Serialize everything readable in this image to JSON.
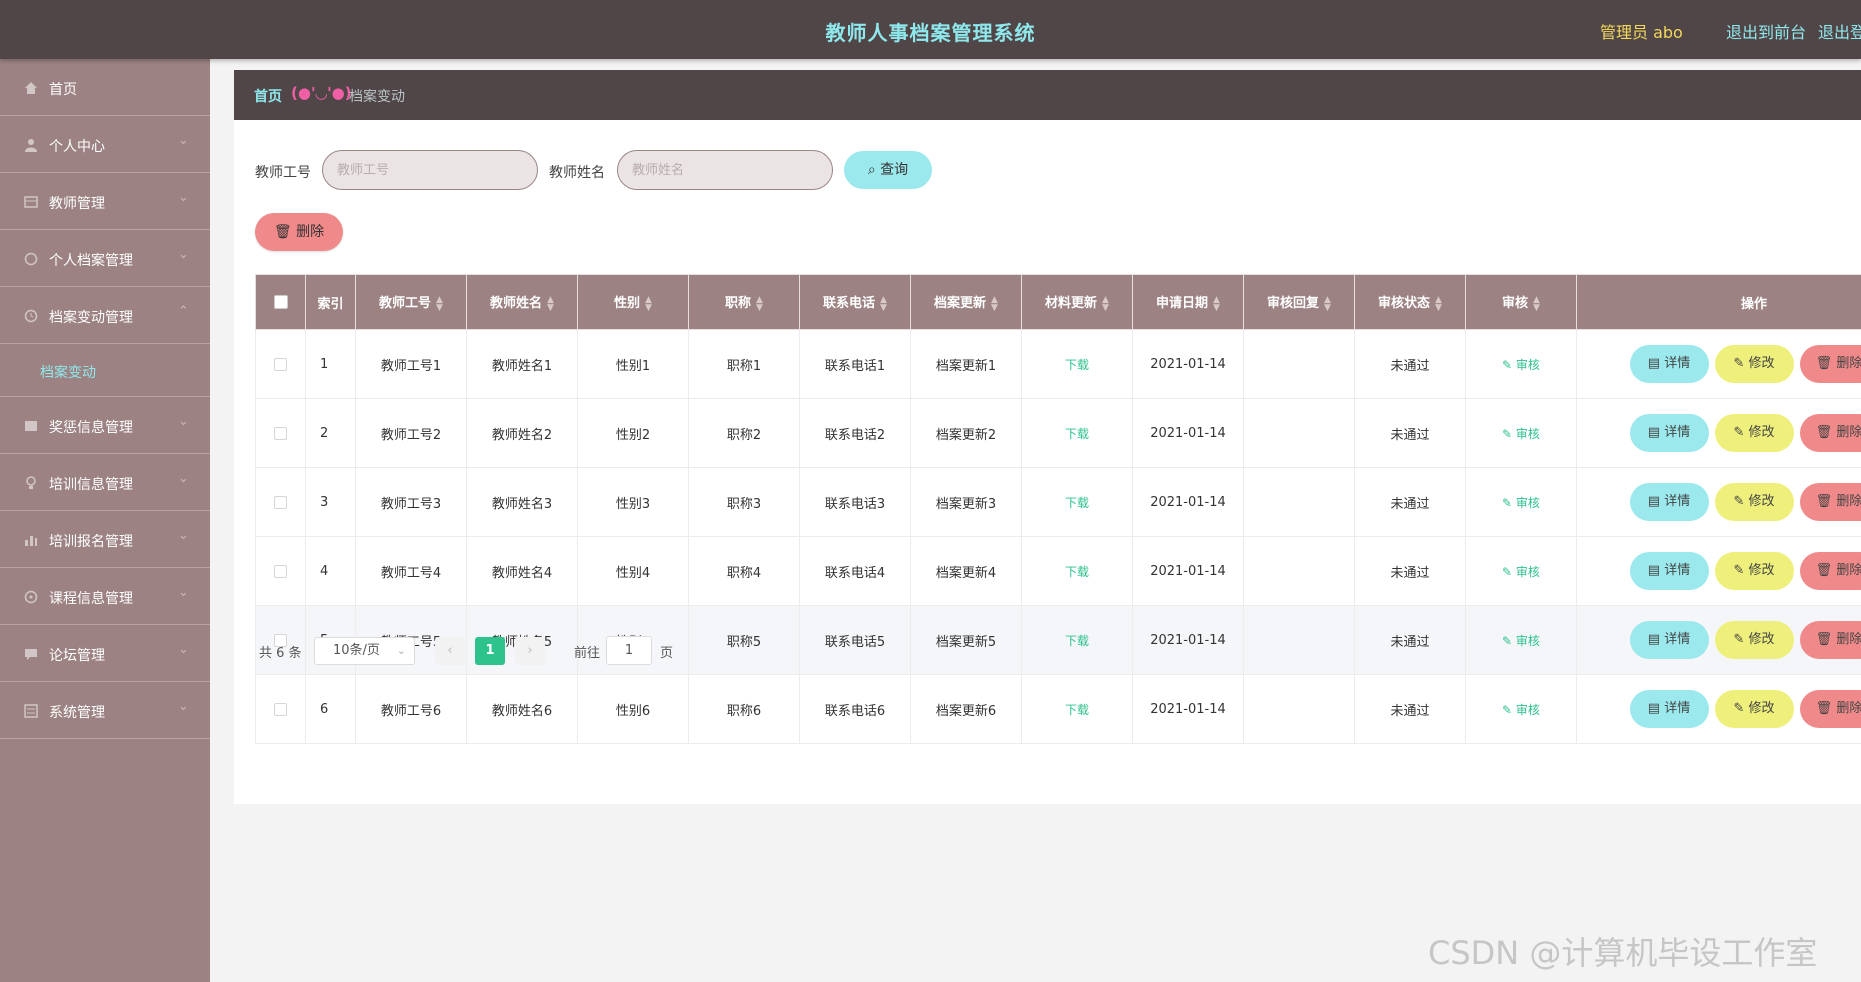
{
  "header": {
    "title": "教师人事档案管理系统",
    "admin": "管理员 abo",
    "to_front": "退出到前台",
    "logout": "退出登录"
  },
  "sidebar": {
    "items": [
      {
        "label": "首页",
        "icon": "home-icon"
      },
      {
        "label": "个人中心",
        "icon": "user-icon"
      },
      {
        "label": "教师管理",
        "icon": "grid-icon"
      },
      {
        "label": "个人档案管理",
        "icon": "chat-icon"
      },
      {
        "label": "档案变动管理",
        "icon": "clock-icon",
        "sub": "档案变动"
      },
      {
        "label": "奖惩信息管理",
        "icon": "chart-icon"
      },
      {
        "label": "培训信息管理",
        "icon": "bulb-icon"
      },
      {
        "label": "培训报名管理",
        "icon": "bar-chart-icon"
      },
      {
        "label": "课程信息管理",
        "icon": "compass-icon"
      },
      {
        "label": "论坛管理",
        "icon": "message-icon"
      },
      {
        "label": "系统管理",
        "icon": "settings-icon"
      }
    ]
  },
  "breadcrumb": {
    "home": "首页",
    "separator": "(●'◡'●)",
    "current": "档案变动"
  },
  "filters": {
    "teacher_no_label": "教师工号",
    "teacher_no_placeholder": "教师工号",
    "teacher_name_label": "教师姓名",
    "teacher_name_placeholder": "教师姓名",
    "query_button": "查询",
    "delete_button": "删除"
  },
  "table": {
    "columns": [
      "索引",
      "教师工号",
      "教师姓名",
      "性别",
      "职称",
      "联系电话",
      "档案更新",
      "材料更新",
      "申请日期",
      "审核回复",
      "审核状态",
      "审核",
      "操作"
    ],
    "rows": [
      {
        "index": "1",
        "no": "教师工号1",
        "name": "教师姓名1",
        "gender": "性别1",
        "title": "职称1",
        "phone": "联系电话1",
        "update": "档案更新1",
        "material": "下载",
        "date": "2021-01-14",
        "reply": "",
        "status": "未通过",
        "audit": "审核"
      },
      {
        "index": "2",
        "no": "教师工号2",
        "name": "教师姓名2",
        "gender": "性别2",
        "title": "职称2",
        "phone": "联系电话2",
        "update": "档案更新2",
        "material": "下载",
        "date": "2021-01-14",
        "reply": "",
        "status": "未通过",
        "audit": "审核"
      },
      {
        "index": "3",
        "no": "教师工号3",
        "name": "教师姓名3",
        "gender": "性别3",
        "title": "职称3",
        "phone": "联系电话3",
        "update": "档案更新3",
        "material": "下载",
        "date": "2021-01-14",
        "reply": "",
        "status": "未通过",
        "audit": "审核"
      },
      {
        "index": "4",
        "no": "教师工号4",
        "name": "教师姓名4",
        "gender": "性别4",
        "title": "职称4",
        "phone": "联系电话4",
        "update": "档案更新4",
        "material": "下载",
        "date": "2021-01-14",
        "reply": "",
        "status": "未通过",
        "audit": "审核"
      },
      {
        "index": "5",
        "no": "教师工号5",
        "name": "教师姓名5",
        "gender": "性别5",
        "title": "职称5",
        "phone": "联系电话5",
        "update": "档案更新5",
        "material": "下载",
        "date": "2021-01-14",
        "reply": "",
        "status": "未通过",
        "audit": "审核"
      },
      {
        "index": "6",
        "no": "教师工号6",
        "name": "教师姓名6",
        "gender": "性别6",
        "title": "职称6",
        "phone": "联系电话6",
        "update": "档案更新6",
        "material": "下载",
        "date": "2021-01-14",
        "reply": "",
        "status": "未通过",
        "audit": "审核"
      }
    ],
    "actions": {
      "detail": "详情",
      "edit": "修改",
      "delete": "删除"
    }
  },
  "pagination": {
    "total": "共 6 条",
    "page_size": "10条/页",
    "current_page": "1",
    "goto_label": "前往",
    "goto_value": "1",
    "page_unit": "页"
  },
  "watermark": "CSDN @计算机毕设工作室",
  "colors": {
    "header_bg": "#514647",
    "sidebar_bg": "#9c8282",
    "accent_cyan": "#9be9ed",
    "accent_yellow": "#eff07c",
    "accent_red": "#f08a8a",
    "accent_green": "#2ec28d"
  }
}
